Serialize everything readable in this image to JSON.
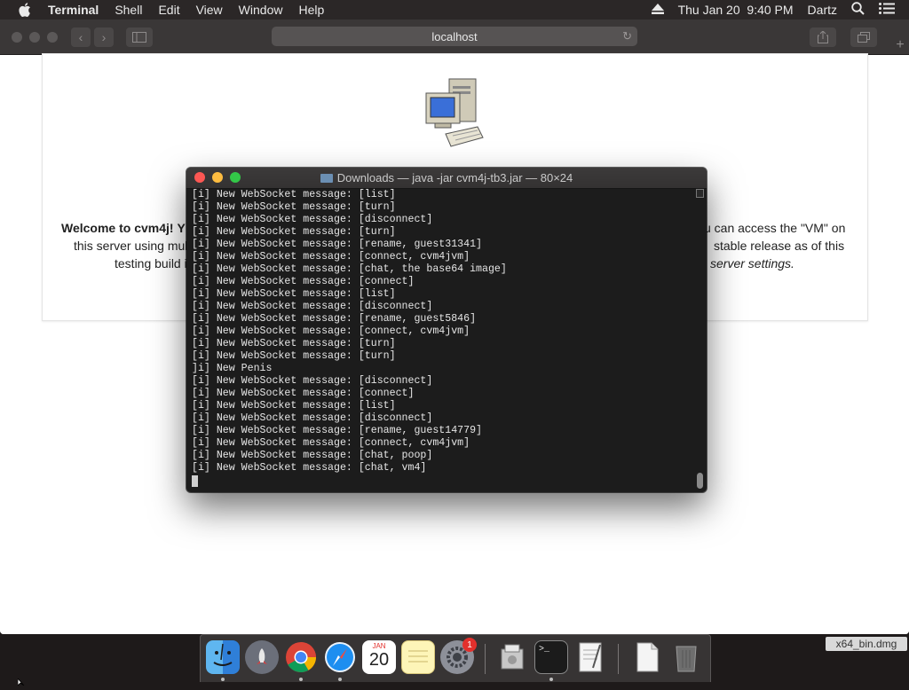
{
  "menubar": {
    "app_name": "Terminal",
    "items": [
      "Shell",
      "Edit",
      "View",
      "Window",
      "Help"
    ],
    "clock": "Thu Jan 20  9:40 PM",
    "user": "Dartz",
    "icons": [
      "apple-icon",
      "eject-icon",
      "spotlight-icon",
      "notification-center-icon"
    ]
  },
  "safari": {
    "url": "localhost"
  },
  "page": {
    "welcome_bold": "Welcome to cvm4j!",
    "line1_left": "Y",
    "line1_right": "u can access the \"VM\" on",
    "line2_left": "this server using mul",
    "line2_right": "stable release as of this",
    "line3_left": "testing build i",
    "line3_right": "server settings."
  },
  "terminal": {
    "title": "Downloads — java -jar cvm4j-tb3.jar — 80×24",
    "lines": [
      "[i] New WebSocket message: [list]",
      "[i] New WebSocket message: [turn]",
      "[i] New WebSocket message: [disconnect]",
      "[i] New WebSocket message: [turn]",
      "[i] New WebSocket message: [rename, guest31341]",
      "[i] New WebSocket message: [connect, cvm4jvm]",
      "[i] New WebSocket message: [chat, the base64 image]",
      "[i] New WebSocket message: [connect]",
      "[i] New WebSocket message: [list]",
      "[i] New WebSocket message: [disconnect]",
      "[i] New WebSocket message: [rename, guest5846]",
      "[i] New WebSocket message: [connect, cvm4jvm]",
      "[i] New WebSocket message: [turn]",
      "[i] New WebSocket message: [turn]",
      "]i] New Penis",
      "[i] New WebSocket message: [disconnect]",
      "[i] New WebSocket message: [connect]",
      "[i] New WebSocket message: [list]",
      "[i] New WebSocket message: [disconnect]",
      "[i] New WebSocket message: [rename, guest14779]",
      "[i] New WebSocket message: [connect, cvm4jvm]",
      "[i] New WebSocket message: [chat, poop]",
      "[i] New WebSocket message: [chat, vm4]"
    ]
  },
  "dock": {
    "calendar_month": "JAN",
    "calendar_day": "20",
    "settings_badge": "1",
    "items": [
      "finder-icon",
      "launchpad-icon",
      "chrome-icon",
      "safari-icon",
      "calendar-icon",
      "notes-icon",
      "system-preferences-icon",
      "disk-utility-icon",
      "terminal-icon",
      "textedit-icon",
      "document-icon",
      "trash-icon"
    ]
  },
  "desktop": {
    "file_label": "x64_bin.dmg"
  },
  "colors": {
    "close": "#fc5753",
    "minimize": "#fdbc40",
    "zoom": "#33c748",
    "badge": "#e2302c"
  }
}
